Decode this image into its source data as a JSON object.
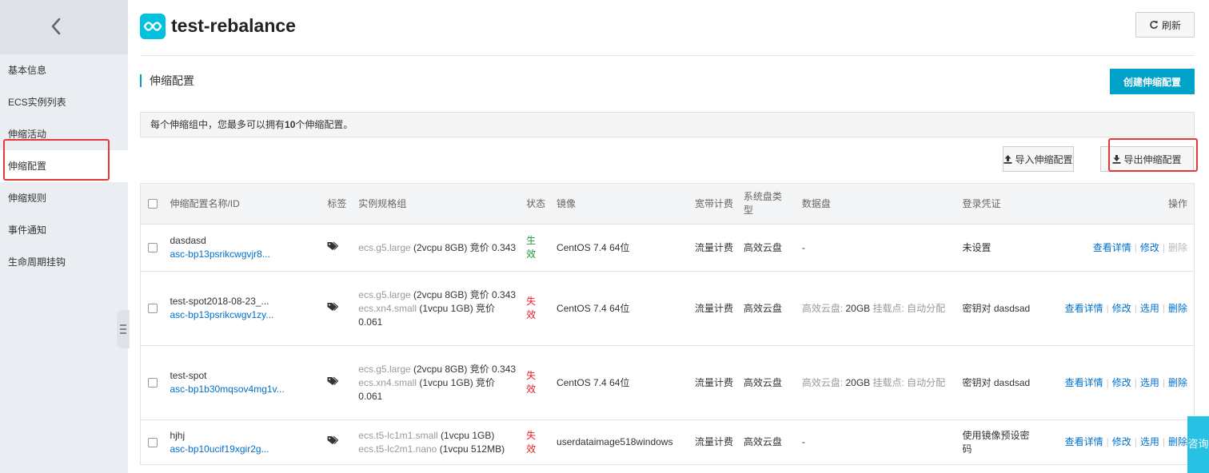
{
  "sidebar": {
    "items": [
      {
        "label": "基本信息"
      },
      {
        "label": "ECS实例列表"
      },
      {
        "label": "伸缩活动"
      },
      {
        "label": "伸缩配置"
      },
      {
        "label": "伸缩规则"
      },
      {
        "label": "事件通知"
      },
      {
        "label": "生命周期挂钩"
      }
    ],
    "active_index": 3
  },
  "header": {
    "title": "test-rebalance",
    "refresh_label": "刷新"
  },
  "section": {
    "title": "伸缩配置",
    "create_label": "创建伸缩配置"
  },
  "notice": {
    "prefix": "每个伸缩组中，您最多可以拥有",
    "count": "10",
    "suffix": "个伸缩配置。"
  },
  "toolbar": {
    "import_label": "导入伸缩配置",
    "export_label": "导出伸缩配置"
  },
  "table": {
    "headers": {
      "name": "伸缩配置名称/ID",
      "tag": "标签",
      "spec": "实例规格组",
      "status": "状态",
      "image": "镜像",
      "bandwidth": "宽带计费",
      "sysdisk": "系统盘类型",
      "datadisk": "数据盘",
      "login": "登录凭证",
      "ops": "操作"
    },
    "rows": [
      {
        "name": "dasdasd",
        "id": "asc-bp13psrikcwgvjr8...",
        "specs": [
          {
            "type": "ecs.g5.large",
            "detail": " (2vcpu 8GB) 竞价 0.343"
          }
        ],
        "status": "生效",
        "image": "CentOS 7.4 64位",
        "bandwidth": "流量计费",
        "sysdisk": "高效云盘",
        "datadisk_label": "",
        "datadisk_size": "-",
        "datadisk_rest": "",
        "login": "未设置",
        "ops": {
          "detail": "查看详情",
          "edit": "修改",
          "use": "",
          "delete": "删除"
        }
      },
      {
        "name": "test-spot2018-08-23_...",
        "id": "asc-bp13psrikcwgv1zy...",
        "specs": [
          {
            "type": "ecs.g5.large",
            "detail": " (2vcpu 8GB) 竞价 0.343"
          },
          {
            "type": "ecs.xn4.small",
            "detail": " (1vcpu 1GB) 竞价 0.061"
          }
        ],
        "status": "失效",
        "image": "CentOS 7.4 64位",
        "bandwidth": "流量计费",
        "sysdisk": "高效云盘",
        "datadisk_label": "高效云盘: ",
        "datadisk_size": "20GB",
        "datadisk_rest": " 挂载点: 自动分配",
        "login": "密钥对 dasdsad",
        "ops": {
          "detail": "查看详情",
          "edit": "修改",
          "use": "选用",
          "delete": "删除"
        }
      },
      {
        "name": "test-spot",
        "id": "asc-bp1b30mqsov4mg1v...",
        "specs": [
          {
            "type": "ecs.g5.large",
            "detail": " (2vcpu 8GB) 竞价 0.343"
          },
          {
            "type": "ecs.xn4.small",
            "detail": " (1vcpu 1GB) 竞价 0.061"
          }
        ],
        "status": "失效",
        "image": "CentOS 7.4 64位",
        "bandwidth": "流量计费",
        "sysdisk": "高效云盘",
        "datadisk_label": "高效云盘: ",
        "datadisk_size": "20GB",
        "datadisk_rest": " 挂载点: 自动分配",
        "login": "密钥对 dasdsad",
        "ops": {
          "detail": "查看详情",
          "edit": "修改",
          "use": "选用",
          "delete": "删除"
        }
      },
      {
        "name": "hjhj",
        "id": "asc-bp10ucif19xgir2g...",
        "specs": [
          {
            "type": "ecs.t5-lc1m1.small",
            "detail": " (1vcpu 1GB)"
          },
          {
            "type": "ecs.t5-lc2m1.nano",
            "detail": " (1vcpu 512MB)"
          }
        ],
        "status": "失效",
        "image": "userdataimage518windows",
        "bandwidth": "流量计费",
        "sysdisk": "高效云盘",
        "datadisk_label": "",
        "datadisk_size": "-",
        "datadisk_rest": "",
        "login": "使用镜像预设密码",
        "ops": {
          "detail": "查看详情",
          "edit": "修改",
          "use": "选用",
          "delete": "删除"
        }
      }
    ]
  },
  "consult": {
    "label": "咨询"
  },
  "colors": {
    "accent": "#00a2ca",
    "link": "#0070cc",
    "active_status": "#1e9a3a",
    "inactive_status": "#e6212a",
    "highlight_box": "#e4393c"
  }
}
